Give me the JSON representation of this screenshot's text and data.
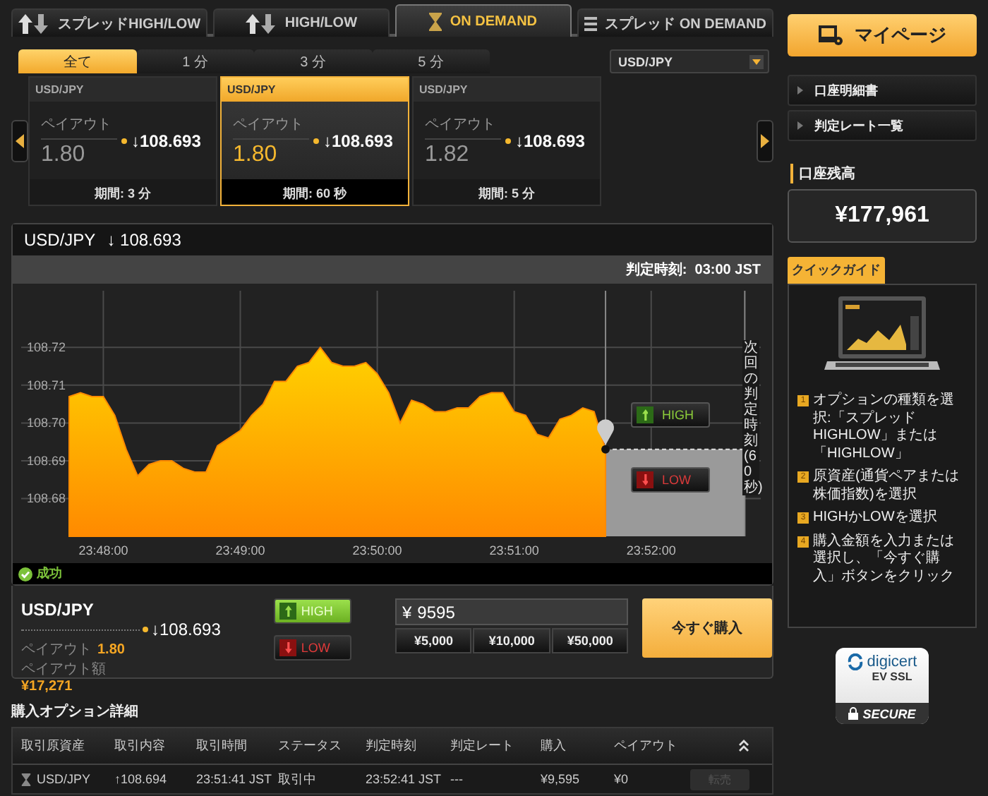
{
  "product_tabs": [
    {
      "label": "スプレッドHIGH/LOW",
      "selected": false
    },
    {
      "label": "HIGH/LOW",
      "selected": false
    },
    {
      "label": "ON DEMAND",
      "selected": true
    },
    {
      "label": "スプレッド ON DEMAND",
      "selected": false
    }
  ],
  "duration_filters": [
    {
      "label": "全て",
      "selected": true
    },
    {
      "label": "1 分",
      "selected": false
    },
    {
      "label": "3 分",
      "selected": false
    },
    {
      "label": "5 分",
      "selected": false
    }
  ],
  "asset_select": {
    "value": "USD/JPY"
  },
  "option_cards": [
    {
      "asset": "USD/JPY",
      "payout_label": "ペイアウト",
      "payout": "1.80",
      "rate": "↓108.693",
      "period": "期間: 3 分",
      "selected": false
    },
    {
      "asset": "USD/JPY",
      "payout_label": "ペイアウト",
      "payout": "1.80",
      "rate": "↓108.693",
      "period": "期間: 60 秒",
      "selected": true
    },
    {
      "asset": "USD/JPY",
      "payout_label": "ペイアウト",
      "payout": "1.82",
      "rate": "↓108.693",
      "period": "期間: 5 分",
      "selected": false
    }
  ],
  "chart_panel": {
    "asset": "USD/JPY",
    "rate": "↓ 108.693",
    "expiry": "判定時刻:  03:00 JST",
    "next_expiry_label": "次回の判定時刻(60秒)",
    "status": "成功",
    "quick_buttons": [
      {
        "label": "HIGH",
        "kind": "high"
      },
      {
        "label": "LOW",
        "kind": "low"
      }
    ],
    "chart_data": {
      "type": "area",
      "grid": true,
      "ylim": [
        108.67,
        108.735
      ],
      "yticks": [
        {
          "value": 108.68,
          "label": "108.68"
        },
        {
          "value": 108.69,
          "label": "108.69"
        },
        {
          "value": 108.7,
          "label": "108.70"
        },
        {
          "value": 108.71,
          "label": "108.71"
        },
        {
          "value": 108.72,
          "label": "108.72"
        }
      ],
      "categories": [
        null,
        null,
        null,
        "23:48:00",
        null,
        null,
        null,
        null,
        null,
        null,
        null,
        null,
        null,
        null,
        null,
        "23:49:00",
        null,
        null,
        null,
        null,
        null,
        null,
        null,
        null,
        null,
        null,
        null,
        "23:50:00",
        null,
        null,
        null,
        null,
        null,
        null,
        null,
        null,
        null,
        null,
        null,
        "23:51:00",
        null,
        null,
        null,
        null,
        null,
        null,
        null,
        null,
        null,
        null,
        null,
        "23:52:00",
        null,
        null,
        null,
        null,
        null,
        null,
        null,
        null,
        null
      ],
      "series": [
        {
          "color": "#ff8a00",
          "values": [
            108.707,
            108.708,
            108.707,
            108.707,
            108.702,
            108.693,
            108.686,
            108.689,
            108.69,
            108.69,
            108.688,
            108.687,
            108.687,
            108.694,
            108.696,
            108.698,
            108.702,
            108.705,
            108.711,
            108.711,
            108.715,
            108.716,
            108.72,
            108.716,
            108.715,
            108.715,
            108.716,
            108.713,
            108.708,
            108.7,
            108.706,
            108.705,
            108.703,
            108.703,
            108.704,
            108.704,
            108.707,
            108.708,
            108.708,
            108.703,
            108.702,
            108.697,
            108.696,
            108.701,
            108.702,
            108.704,
            108.703,
            108.693,
            null,
            null,
            null,
            null,
            null,
            null,
            null,
            null,
            null,
            null,
            null,
            null,
            null
          ]
        }
      ]
    }
  },
  "trade": {
    "asset": "USD/JPY",
    "rate": "↓108.693",
    "payout_label": "ペイアウト",
    "payout": "1.80",
    "payout_amount_label": "ペイアウト額",
    "payout_amount": "¥17,271",
    "directions": [
      {
        "label": "HIGH",
        "kind": "high",
        "selected": true
      },
      {
        "label": "LOW",
        "kind": "low",
        "selected": false
      }
    ],
    "amount": {
      "currency": "¥",
      "value": "9595"
    },
    "presets": [
      "¥5,000",
      "¥10,000",
      "¥50,000"
    ],
    "buy_button": "今すぐ購入"
  },
  "details": {
    "title": "購入オプション詳細",
    "columns": [
      "取引原資産",
      "取引内容",
      "取引時間",
      "ステータス",
      "判定時刻",
      "判定レート",
      "購入",
      "ペイアウト"
    ],
    "rows": [
      {
        "asset": "USD/JPY",
        "rate": "↑108.694",
        "time": "23:51:41 JST",
        "status": "取引中",
        "expiry": "23:52:41 JST",
        "expiry_rate": "---",
        "purchase": "¥9,595",
        "payout": "¥0",
        "resell": {
          "label": "転売",
          "disabled": true
        }
      }
    ]
  },
  "sidebar": {
    "mypage_button": "マイページ",
    "links": [
      "口座明細書",
      "判定レート一覧"
    ],
    "balance_label": "口座残高",
    "balance": "¥177,961",
    "guide": {
      "tab": "クイックガイド",
      "steps": [
        {
          "number": "1",
          "text": "オプションの種類を選択:「スプレッドHIGHLOW」または「HIGHLOW」"
        },
        {
          "number": "2",
          "text": "原資産(通貨ペアまたは株価指数)を選択"
        },
        {
          "number": "3",
          "text": "HIGHかLOWを選択"
        },
        {
          "number": "4",
          "text": "購入金額を入力または選択し、「今すぐ購入」ボタンをクリック"
        }
      ]
    }
  },
  "badge": {
    "brand": "digicert",
    "line2": "EV SSL",
    "line3": "SECURE"
  }
}
